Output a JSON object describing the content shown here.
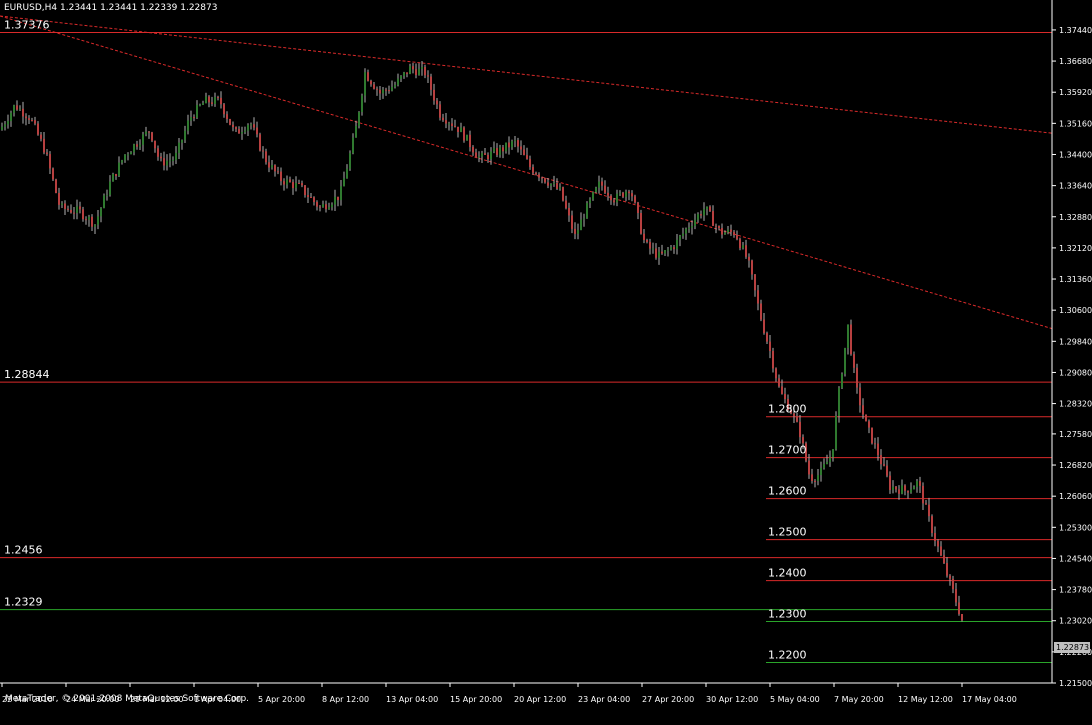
{
  "header": {
    "title": "EURUSD,H4",
    "ohlc": "1.23441 1.23441 1.22339 1.22873"
  },
  "copyright": "MetaTrader, © 2001-2008 MetaQuotes Software Corp.",
  "current_price": "1.22873",
  "colors": {
    "background": "#000000",
    "axis": "#ffffff",
    "bull_candle": "#2f7a2f",
    "bear_candle": "#b84040",
    "wick": "#b0b0b0",
    "hline_red": "#d92a2a",
    "hline_green": "#2aa52a",
    "trendline": "#d92a2a",
    "price_tag_bg": "#c0c0c0"
  },
  "chart_data": {
    "type": "candlestick",
    "symbol": "EURUSD",
    "timeframe": "H4",
    "ylim": [
      1.215,
      1.3778
    ],
    "y_ticks": [
      "1.37440",
      "1.36680",
      "1.35920",
      "1.35160",
      "1.34400",
      "1.33640",
      "1.32880",
      "1.32120",
      "1.31360",
      "1.30600",
      "1.29840",
      "1.29080",
      "1.28320",
      "1.27580",
      "1.26820",
      "1.26060",
      "1.25300",
      "1.24540",
      "1.23780",
      "1.23020",
      "1.22260",
      "1.21500"
    ],
    "x_ticks": [
      "22 Mar 2010",
      "24 Mar 20:00",
      "29 Mar 12:00",
      "1 Apr 04:00",
      "5 Apr 20:00",
      "8 Apr 12:00",
      "13 Apr 04:00",
      "15 Apr 20:00",
      "20 Apr 12:00",
      "23 Apr 04:00",
      "27 Apr 20:00",
      "30 Apr 12:00",
      "5 May 04:00",
      "7 May 20:00",
      "12 May 12:00",
      "17 May 04:00"
    ],
    "horizontal_lines": [
      {
        "label": "1.37376",
        "price": 1.37376,
        "color": "red",
        "from": "left"
      },
      {
        "label": "1.28844",
        "price": 1.28844,
        "color": "red",
        "from": "left"
      },
      {
        "label": "1.2800",
        "price": 1.28,
        "color": "red",
        "from": "mid"
      },
      {
        "label": "1.2700",
        "price": 1.27,
        "color": "red",
        "from": "mid"
      },
      {
        "label": "1.2600",
        "price": 1.26,
        "color": "red",
        "from": "mid"
      },
      {
        "label": "1.2500",
        "price": 1.25,
        "color": "red",
        "from": "mid"
      },
      {
        "label": "1.2456",
        "price": 1.2456,
        "color": "red",
        "from": "left"
      },
      {
        "label": "1.2400",
        "price": 1.24,
        "color": "red",
        "from": "mid"
      },
      {
        "label": "1.2329",
        "price": 1.2329,
        "color": "green",
        "from": "left"
      },
      {
        "label": "1.2300",
        "price": 1.23,
        "color": "green",
        "from": "mid"
      },
      {
        "label": "1.2200",
        "price": 1.22,
        "color": "green",
        "from": "mid"
      }
    ],
    "trendlines": [
      {
        "p1": {
          "bar": 0,
          "price": 1.3778
        },
        "p2": {
          "bar": 1052,
          "price": 1.3492
        }
      },
      {
        "p1": {
          "bar": 0,
          "price": 1.3778
        },
        "p2": {
          "bar": 1052,
          "price": 1.3015
        }
      }
    ],
    "close_path": [
      {
        "t": 0,
        "price": 1.35
      },
      {
        "t": 15,
        "price": 1.356
      },
      {
        "t": 30,
        "price": 1.353
      },
      {
        "t": 45,
        "price": 1.345
      },
      {
        "t": 60,
        "price": 1.331
      },
      {
        "t": 80,
        "price": 1.33
      },
      {
        "t": 95,
        "price": 1.327
      },
      {
        "t": 110,
        "price": 1.337
      },
      {
        "t": 125,
        "price": 1.344
      },
      {
        "t": 150,
        "price": 1.35
      },
      {
        "t": 160,
        "price": 1.342
      },
      {
        "t": 175,
        "price": 1.343
      },
      {
        "t": 190,
        "price": 1.353
      },
      {
        "t": 205,
        "price": 1.357
      },
      {
        "t": 220,
        "price": 1.357
      },
      {
        "t": 235,
        "price": 1.349
      },
      {
        "t": 250,
        "price": 1.352
      },
      {
        "t": 265,
        "price": 1.343
      },
      {
        "t": 280,
        "price": 1.338
      },
      {
        "t": 300,
        "price": 1.336
      },
      {
        "t": 320,
        "price": 1.331
      },
      {
        "t": 340,
        "price": 1.334
      },
      {
        "t": 355,
        "price": 1.349
      },
      {
        "t": 365,
        "price": 1.364
      },
      {
        "t": 380,
        "price": 1.359
      },
      {
        "t": 395,
        "price": 1.361
      },
      {
        "t": 410,
        "price": 1.365
      },
      {
        "t": 425,
        "price": 1.364
      },
      {
        "t": 440,
        "price": 1.354
      },
      {
        "t": 460,
        "price": 1.35
      },
      {
        "t": 480,
        "price": 1.343
      },
      {
        "t": 500,
        "price": 1.345
      },
      {
        "t": 515,
        "price": 1.347
      },
      {
        "t": 530,
        "price": 1.341
      },
      {
        "t": 545,
        "price": 1.338
      },
      {
        "t": 560,
        "price": 1.335
      },
      {
        "t": 575,
        "price": 1.324
      },
      {
        "t": 585,
        "price": 1.33
      },
      {
        "t": 600,
        "price": 1.337
      },
      {
        "t": 615,
        "price": 1.333
      },
      {
        "t": 630,
        "price": 1.336
      },
      {
        "t": 645,
        "price": 1.322
      },
      {
        "t": 660,
        "price": 1.319
      },
      {
        "t": 675,
        "price": 1.322
      },
      {
        "t": 690,
        "price": 1.327
      },
      {
        "t": 705,
        "price": 1.331
      },
      {
        "t": 720,
        "price": 1.325
      },
      {
        "t": 735,
        "price": 1.325
      },
      {
        "t": 748,
        "price": 1.318
      },
      {
        "t": 760,
        "price": 1.305
      },
      {
        "t": 770,
        "price": 1.296
      },
      {
        "t": 780,
        "price": 1.286
      },
      {
        "t": 790,
        "price": 1.282
      },
      {
        "t": 800,
        "price": 1.276
      },
      {
        "t": 810,
        "price": 1.265
      },
      {
        "t": 820,
        "price": 1.266
      },
      {
        "t": 832,
        "price": 1.271
      },
      {
        "t": 840,
        "price": 1.288
      },
      {
        "t": 848,
        "price": 1.302
      },
      {
        "t": 856,
        "price": 1.287
      },
      {
        "t": 866,
        "price": 1.278
      },
      {
        "t": 878,
        "price": 1.271
      },
      {
        "t": 890,
        "price": 1.263
      },
      {
        "t": 905,
        "price": 1.262
      },
      {
        "t": 918,
        "price": 1.264
      },
      {
        "t": 930,
        "price": 1.254
      },
      {
        "t": 942,
        "price": 1.245
      },
      {
        "t": 952,
        "price": 1.238
      },
      {
        "t": 960,
        "price": 1.232
      },
      {
        "t": 964,
        "price": 1.2287
      }
    ]
  }
}
